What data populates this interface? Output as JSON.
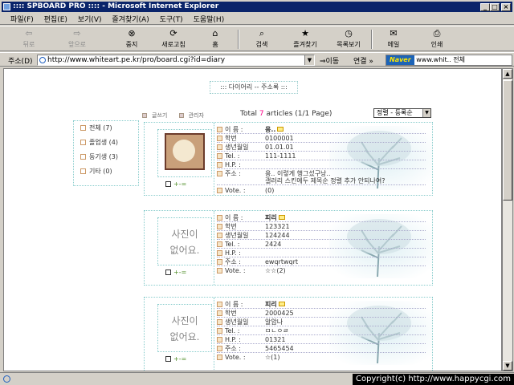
{
  "window": {
    "title": ":::: SPBOARD PRO :::: - Microsoft Internet Explorer",
    "btn_min": "_",
    "btn_max": "□",
    "btn_close": "×"
  },
  "menu": [
    "파일(F)",
    "편집(E)",
    "보기(V)",
    "즐겨찾기(A)",
    "도구(T)",
    "도움말(H)"
  ],
  "toolbar": {
    "back": "뒤로",
    "forward": "앞으로",
    "stop": "중지",
    "refresh": "새로고침",
    "home": "홈",
    "search": "검색",
    "favorites": "즐겨찾기",
    "history": "목록보기",
    "mail": "메일",
    "print": "인쇄"
  },
  "address": {
    "label": "주소(D)",
    "url": "http://www.whiteart.pe.kr/pro/board.cgi?id=diary",
    "go": "이동",
    "links": "연결 »",
    "naver_logo": "Naver",
    "naver_text": "www.whit..  전체"
  },
  "page": {
    "title": "::: 다이어리 -- 주소록 :::",
    "write_link": "글쓰기",
    "admin_link": "관리자",
    "total_prefix": "Total ",
    "total_count": "7",
    "total_suffix": " articles (1/1 Page)",
    "sort_value": "정렬 - 등록순"
  },
  "categories": [
    {
      "label": "전체 (7)"
    },
    {
      "label": "졸업생 (4)"
    },
    {
      "label": "동기생 (3)"
    },
    {
      "label": "기타 (0)"
    }
  ],
  "entry_labels": {
    "name": "이    름 :",
    "id": "학번",
    "birthday": "생년월일",
    "tel": "Tel. :",
    "hp": "H.P. :",
    "addr": "주소 :",
    "vote": "Vote. :",
    "nophoto": "사진이\n없어요.",
    "controls": "+-="
  },
  "entries": [
    {
      "name": "용..",
      "id": "0100001",
      "birthday": "01.01.01",
      "tel": "111-1111",
      "hp": "",
      "addr1": "용.. 이렇게 행그섰구낭..",
      "addr2": "갤러리 스킨에두 제목순 정렬 추가 안되나여?",
      "vote": "(0)",
      "has_photo": true
    },
    {
      "name": "피리",
      "id": "123321",
      "birthday": "124244",
      "tel": "2424",
      "hp": "",
      "addr1": "ewqrtwqrt",
      "addr2": "",
      "vote": "☆☆(2)",
      "has_photo": false
    },
    {
      "name": "피리",
      "id": "2000425",
      "birthday": "알암나",
      "tel": "ㅁㄴㅇㄹ",
      "hp": "01321",
      "addr1": "5465454",
      "addr2": "",
      "vote": "☆(1)",
      "has_photo": false
    }
  ],
  "status": {
    "copyright": "Copyright(c) http://www.happycgi.com"
  }
}
